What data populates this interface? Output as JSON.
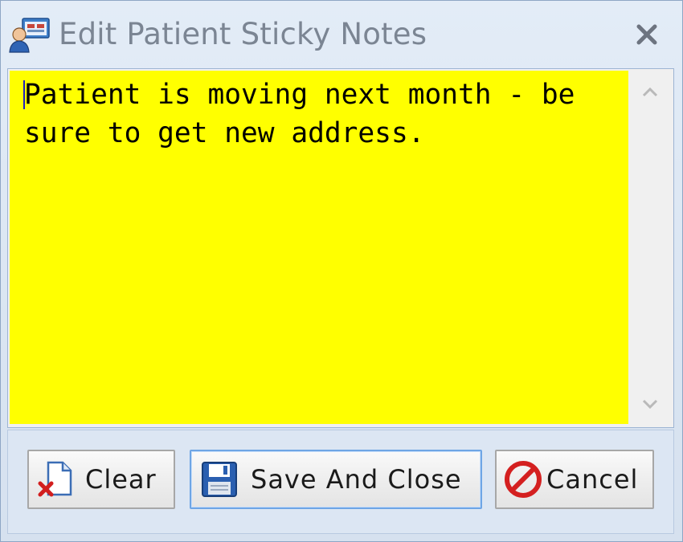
{
  "window": {
    "title": "Edit Patient Sticky Notes",
    "icon": "patient-card-icon",
    "close_icon": "close-icon"
  },
  "note": {
    "text": "Patient is moving next month - be sure to get new address.",
    "background_color": "#ffff00"
  },
  "buttons": {
    "clear": {
      "label": "Clear",
      "icon": "clear-document-icon"
    },
    "save": {
      "label": "Save And Close",
      "icon": "floppy-disk-icon"
    },
    "cancel": {
      "label": "Cancel",
      "icon": "cancel-icon"
    }
  }
}
